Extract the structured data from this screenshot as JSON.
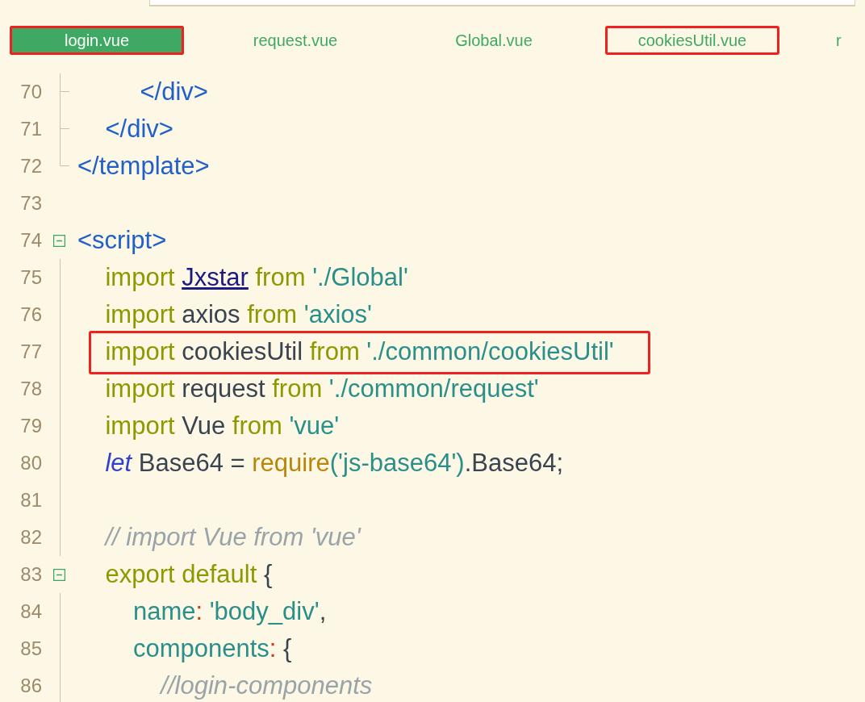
{
  "tabs": [
    {
      "label": "login.vue",
      "selected": true,
      "highlighted": true
    },
    {
      "label": "request.vue",
      "selected": false,
      "highlighted": false
    },
    {
      "label": "Global.vue",
      "selected": false,
      "highlighted": false
    },
    {
      "label": "cookiesUtil.vue",
      "selected": false,
      "highlighted": true
    },
    {
      "label": "r",
      "selected": false,
      "highlighted": false
    }
  ],
  "lines": [
    {
      "number": "70",
      "kind": "tick",
      "highlighted": false,
      "tokens": [
        {
          "text": "         </div>",
          "kind": "tag"
        }
      ]
    },
    {
      "number": "71",
      "kind": "tick",
      "highlighted": false,
      "tokens": [
        {
          "text": "    </div>",
          "kind": "tag"
        }
      ]
    },
    {
      "number": "72",
      "kind": "corner",
      "highlighted": false,
      "tokens": [
        {
          "text": "</template>",
          "kind": "tag"
        }
      ]
    },
    {
      "number": "73",
      "kind": "none",
      "highlighted": false
    },
    {
      "number": "74",
      "kind": "box",
      "highlighted": false,
      "tokens": [
        {
          "text": "<script>",
          "kind": "tag"
        }
      ]
    },
    {
      "number": "75",
      "kind": "line",
      "highlighted": false,
      "tokens": [
        {
          "text": "    import ",
          "kind": "keyword"
        },
        {
          "text": "Jxstar",
          "kind": "link"
        },
        {
          "text": " from ",
          "kind": "keyword"
        },
        {
          "text": "'./Global'",
          "kind": "string"
        }
      ]
    },
    {
      "number": "76",
      "kind": "line",
      "highlighted": false,
      "tokens": [
        {
          "text": "    import ",
          "kind": "keyword"
        },
        {
          "text": "axios",
          "kind": "ident"
        },
        {
          "text": " from ",
          "kind": "keyword"
        },
        {
          "text": "'axios'",
          "kind": "string"
        }
      ]
    },
    {
      "number": "77",
      "kind": "line",
      "highlighted": true,
      "tokens": [
        {
          "text": "    import ",
          "kind": "keyword"
        },
        {
          "text": "cookiesUtil",
          "kind": "ident"
        },
        {
          "text": " from ",
          "kind": "keyword"
        },
        {
          "text": "'./common/cookiesUtil'",
          "kind": "string"
        }
      ]
    },
    {
      "number": "78",
      "kind": "line",
      "highlighted": false,
      "tokens": [
        {
          "text": "    import ",
          "kind": "keyword"
        },
        {
          "text": "request",
          "kind": "ident"
        },
        {
          "text": " from ",
          "kind": "keyword"
        },
        {
          "text": "'./common/request'",
          "kind": "string"
        }
      ]
    },
    {
      "number": "79",
      "kind": "line",
      "highlighted": false,
      "tokens": [
        {
          "text": "    import ",
          "kind": "keyword"
        },
        {
          "text": "Vue",
          "kind": "ident"
        },
        {
          "text": " from ",
          "kind": "keyword"
        },
        {
          "text": "'vue'",
          "kind": "string"
        }
      ]
    },
    {
      "number": "80",
      "kind": "line",
      "highlighted": false,
      "tokens": [
        {
          "text": "    let",
          "kind": "let"
        },
        {
          "text": " Base64 = ",
          "kind": "ident"
        },
        {
          "text": "require",
          "kind": "call"
        },
        {
          "text": "('js-base64')",
          "kind": "string"
        },
        {
          "text": ".Base64;",
          "kind": "ident"
        }
      ]
    },
    {
      "number": "81",
      "kind": "line",
      "highlighted": false
    },
    {
      "number": "82",
      "kind": "line",
      "highlighted": false,
      "tokens": [
        {
          "text": "    // import Vue from 'vue'",
          "kind": "comment"
        }
      ]
    },
    {
      "number": "83",
      "kind": "box",
      "highlighted": false,
      "tokens": [
        {
          "text": "    export default ",
          "kind": "keyword"
        },
        {
          "text": "{",
          "kind": "ident"
        }
      ]
    },
    {
      "number": "84",
      "kind": "line",
      "highlighted": false,
      "tokens": [
        {
          "text": "        name",
          "kind": "property"
        },
        {
          "text": ":",
          "kind": "colon"
        },
        {
          "text": " 'body_div'",
          "kind": "string"
        },
        {
          "text": ",",
          "kind": "ident"
        }
      ]
    },
    {
      "number": "85",
      "kind": "line",
      "highlighted": false,
      "tokens": [
        {
          "text": "        components",
          "kind": "property"
        },
        {
          "text": ":",
          "kind": "colon"
        },
        {
          "text": " {",
          "kind": "ident"
        }
      ]
    },
    {
      "number": "86",
      "kind": "line",
      "highlighted": false,
      "tokens": [
        {
          "text": "            //login-components",
          "kind": "comment"
        }
      ]
    }
  ]
}
